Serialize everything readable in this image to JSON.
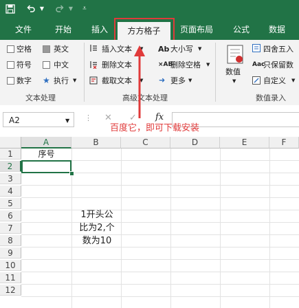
{
  "quick_access": {
    "save_icon": "save-icon",
    "undo_icon": "undo-icon",
    "redo_icon": "redo-icon"
  },
  "tabs": [
    {
      "label": "文件"
    },
    {
      "label": "开始"
    },
    {
      "label": "插入"
    },
    {
      "label": "方方格子",
      "active": true
    },
    {
      "label": "页面布局"
    },
    {
      "label": "公式"
    },
    {
      "label": "数据"
    }
  ],
  "ribbon": {
    "text_processing": {
      "items": [
        {
          "label": "空格",
          "checked": false
        },
        {
          "label": "英文",
          "checked": true
        },
        {
          "label": "符号",
          "checked": false
        },
        {
          "label": "中文",
          "checked": false
        },
        {
          "label": "数字",
          "checked": false
        },
        {
          "label": "执行"
        }
      ],
      "group_label": "文本处理"
    },
    "advanced_text": {
      "insert_text": "插入文本",
      "delete_text": "删除文本",
      "truncate_text": "截取文本",
      "case": "大小写",
      "delete_spaces": "删除空格",
      "more": "更多",
      "group_label": "高级文本处理"
    },
    "number_entry": {
      "value_button": "数值",
      "round": "四舍五入",
      "keep_only": "只保留数",
      "custom": "自定义",
      "group_label": "数值录入"
    }
  },
  "formula_bar": {
    "name_box": "A2",
    "fx": "fx"
  },
  "annotation": "百度它，即可下载安装",
  "sheet": {
    "columns": [
      "A",
      "B",
      "C",
      "D",
      "E",
      "F"
    ],
    "rows": [
      "1",
      "2",
      "3",
      "4",
      "5",
      "6",
      "7",
      "8",
      "9",
      "10",
      "11",
      "12"
    ],
    "cells": {
      "A1": "序号"
    },
    "selected": "A2",
    "textbox_lines": [
      "1开头公",
      "比为2,个",
      "数为10"
    ]
  },
  "colors": {
    "excel_green": "#217346",
    "highlight_red": "#e03a3a",
    "selection": "#217346"
  }
}
